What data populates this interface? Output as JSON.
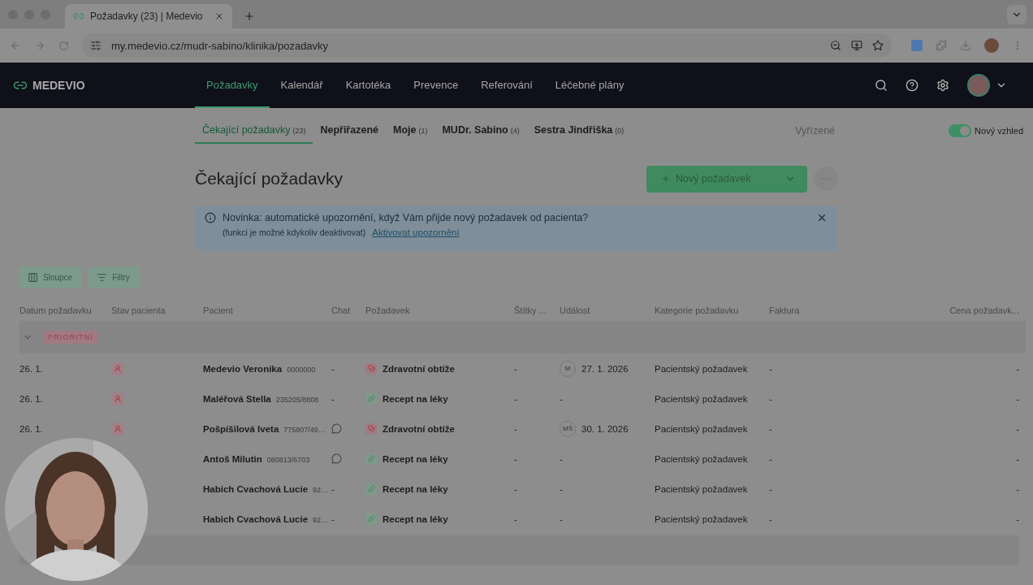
{
  "browser": {
    "tab_title": "Požadavky (23) | Medevio",
    "url": "my.medevio.cz/mudr-sabino/klinika/pozadavky"
  },
  "nav": {
    "brand": "MEDEVIO",
    "items": [
      {
        "label": "Požadavky",
        "selected": true
      },
      {
        "label": "Kalendář",
        "selected": false
      },
      {
        "label": "Kartotéka",
        "selected": false
      },
      {
        "label": "Prevence",
        "selected": false
      },
      {
        "label": "Referování",
        "selected": false
      },
      {
        "label": "Léčebné plány",
        "selected": false
      }
    ]
  },
  "subtabs": [
    {
      "label": "Čekající požadavky",
      "count": "(23)",
      "selected": true
    },
    {
      "label": "Nepřiřazené",
      "selected": false
    },
    {
      "label": "Moje",
      "count": "(1)",
      "selected": false
    },
    {
      "label": "MUDr. Sabino",
      "count": "(4)",
      "selected": false
    },
    {
      "label": "Sestra Jindřiška",
      "count": "(0)",
      "selected": false
    }
  ],
  "resolved_link": "Vyřízené",
  "toggle": {
    "label": "Nový vzhled",
    "on": true
  },
  "title": "Čekající požadavky",
  "new_button": "Nový požadavek",
  "banner": {
    "message": "Novinka: automatické upozornění, když Vám přijde nový požadavek od pacienta?",
    "note": "(funkci je možné kdykoliv deaktivovat)",
    "link": "Aktivovat upozornění"
  },
  "toolbar": [
    {
      "kind": "columns",
      "label": "Sloupce"
    },
    {
      "kind": "filter",
      "label": "Filtry"
    }
  ],
  "table": {
    "columns": [
      "Datum požadavku",
      "Stav pacienta",
      "Pacient",
      "Chat",
      "Požadavek",
      "Štítky ...",
      "Událost",
      "Kategorie požadavku",
      "Faktura",
      "Cena požadavk..."
    ],
    "group": {
      "label": "PRIORITNÍ",
      "expanded": true
    },
    "rows": [
      {
        "date": "26. 1.",
        "flagged": true,
        "patient": "Medevio Veronika",
        "patient_id": "0000000",
        "chat": {
          "kind": "none",
          "text": "-"
        },
        "request": {
          "kind": "health",
          "label": "Zdravotní obtíže"
        },
        "tags": "-",
        "event": {
          "initials": "M",
          "date": "27. 1. 2026"
        },
        "category": "Pacientský požadavek",
        "invoice": "-",
        "price": "-"
      },
      {
        "date": "26. 1.",
        "flagged": true,
        "patient": "Maléřová Stella",
        "patient_id": "235205/8808",
        "chat": {
          "kind": "none",
          "text": "-"
        },
        "request": {
          "kind": "prescription",
          "label": "Recept na léky"
        },
        "tags": "-",
        "event": {
          "date": "-"
        },
        "category": "Pacientský požadavek",
        "invoice": "-",
        "price": "-"
      },
      {
        "date": "26. 1.",
        "flagged": true,
        "patient": "Pošpíšilová Iveta",
        "patient_id": "775807/49…",
        "chat": {
          "kind": "chat"
        },
        "request": {
          "kind": "health",
          "label": "Zdravotní obtíže"
        },
        "tags": "-",
        "event": {
          "initials": "MŠ",
          "date": "30. 1. 2026"
        },
        "category": "Pacientský požadavek",
        "invoice": "-",
        "price": "-"
      },
      {
        "patient": "Antoš Milutin",
        "patient_id": "080813/6703",
        "chat": {
          "kind": "chat"
        },
        "request": {
          "kind": "prescription",
          "label": "Recept na léky"
        },
        "tags": "-",
        "event": {
          "date": "-"
        },
        "category": "Pacientský požadavek",
        "invoice": "-",
        "price": "-"
      },
      {
        "patient": "Habich Cvachová Lucie",
        "patient_id": "92…",
        "chat": {
          "kind": "none",
          "text": "-"
        },
        "request": {
          "kind": "prescription",
          "label": "Recept na léky"
        },
        "tags": "-",
        "event": {
          "date": "-"
        },
        "category": "Pacientský požadavek",
        "invoice": "-",
        "price": "-"
      },
      {
        "patient": "Habich Cvachová Lucie",
        "patient_id": "92…",
        "chat": {
          "kind": "none",
          "text": "-"
        },
        "request": {
          "kind": "prescription",
          "label": "Recept na léky"
        },
        "tags": "-",
        "event": {
          "date": "-"
        },
        "category": "Pacientský požadavek",
        "invoice": "-",
        "price": "-"
      }
    ]
  }
}
